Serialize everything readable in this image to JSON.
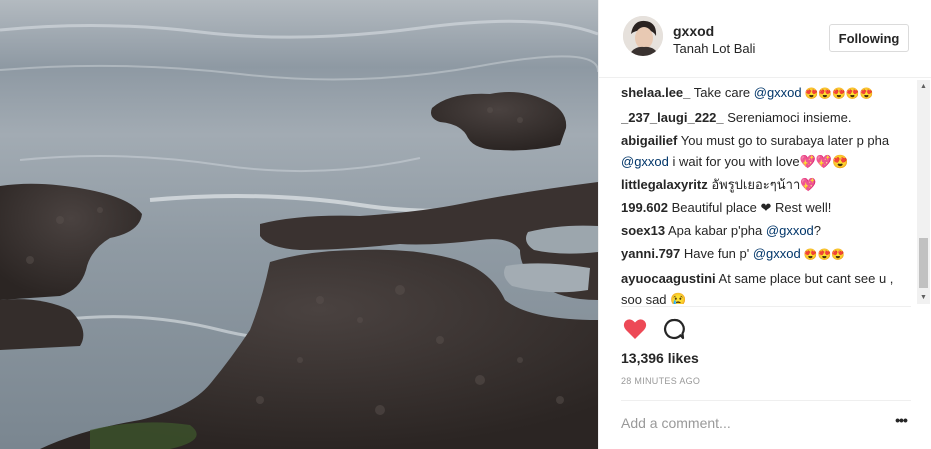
{
  "post": {
    "username": "gxxod",
    "location": "Tanah Lot Bali",
    "follow_label": "Following",
    "likes": "13,396 likes",
    "timestamp": "28 MINUTES AGO",
    "comment_placeholder": "Add a comment...",
    "more_label": "•••"
  },
  "comments": [
    {
      "author": "shelaa.lee_",
      "pre": " Take care ",
      "mention": "@gxxod",
      "post": " 😍😍😍😍😍"
    },
    {
      "author": "_237_laugi_222_",
      "pre": " Sereniamoci insieme.",
      "mention": "",
      "post": ""
    },
    {
      "author": "abigailief",
      "pre": " You must go to surabaya later p pha ",
      "mention": "@gxxod",
      "post": " i wait for you with love💖💖😍"
    },
    {
      "author": "littlegalaxyritz",
      "pre": " อัพรูปเยอะๆน้าา💖",
      "mention": "",
      "post": ""
    },
    {
      "author": "199.602",
      "pre": " Beautiful place ❤ Rest well!",
      "mention": "",
      "post": ""
    },
    {
      "author": "soex13",
      "pre": " Apa kabar p'pha ",
      "mention": "@gxxod",
      "post": "?"
    },
    {
      "author": "yanni.797",
      "pre": " Have fun p' ",
      "mention": "@gxxod",
      "post": " 😍😍😍"
    },
    {
      "author": "ayuocaagustini",
      "pre": " At same place but cant see u , soo sad 😢",
      "mention": "",
      "post": ""
    }
  ],
  "icons": {
    "heart": "heart-icon",
    "comment": "comment-bubble-icon",
    "scroll_up": "chevron-up-icon",
    "scroll_down": "chevron-down-icon"
  },
  "colors": {
    "heart": "#ed4956",
    "mention": "#003569",
    "timestamp": "#999999"
  }
}
